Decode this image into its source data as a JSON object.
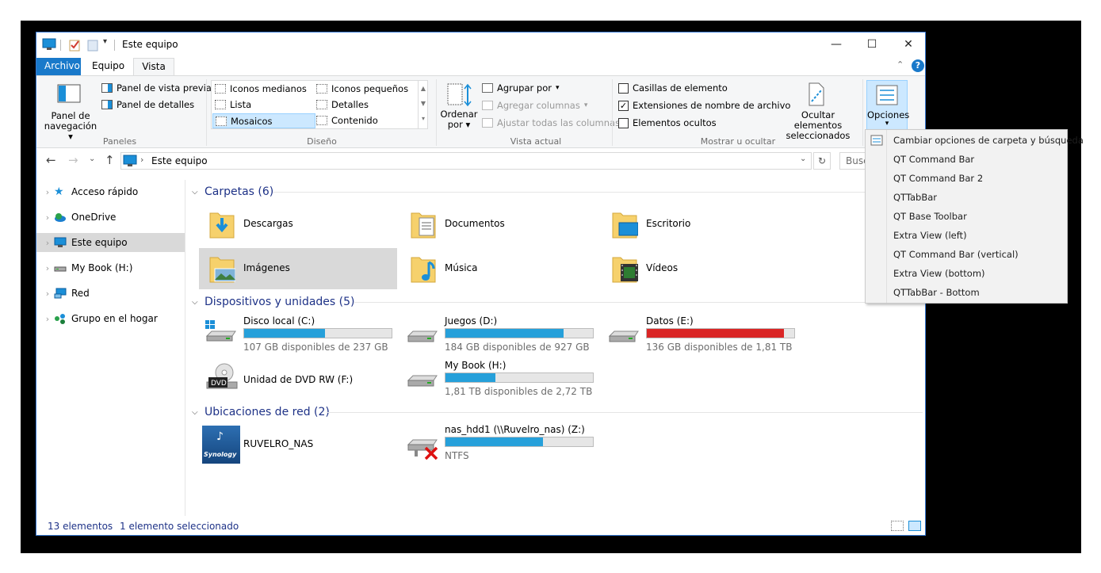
{
  "window": {
    "title": "Este equipo",
    "controls": {
      "minimize": "—",
      "maximize": "☐",
      "close": "✕"
    }
  },
  "tabs": [
    {
      "label": "Archivo"
    },
    {
      "label": "Equipo"
    },
    {
      "label": "Vista"
    }
  ],
  "ribbon": {
    "panes": {
      "nav_pane_label": "Panel de navegación",
      "preview_pane": "Panel de vista previa",
      "details_pane": "Panel de detalles",
      "group_label": "Paneles"
    },
    "layout": {
      "items": [
        "Iconos medianos",
        "Iconos pequeños",
        "Lista",
        "Detalles",
        "Mosaicos",
        "Contenido"
      ],
      "selected": "Mosaicos",
      "group_label": "Diseño"
    },
    "current_view": {
      "sort_label": "Ordenar por",
      "group_by": "Agrupar por",
      "add_columns": "Agregar columnas",
      "fit_columns": "Ajustar todas las columnas",
      "group_label": "Vista actual"
    },
    "show_hide": {
      "item_checkboxes": {
        "label": "Casillas de elemento",
        "checked": false
      },
      "file_extensions": {
        "label": "Extensiones de nombre de archivo",
        "checked": true
      },
      "hidden_items": {
        "label": "Elementos ocultos",
        "checked": false
      },
      "hide_selected": "Ocultar elementos seleccionados",
      "group_label": "Mostrar u ocultar"
    },
    "options_label": "Opciones"
  },
  "address": {
    "path": "Este equipo",
    "search_placeholder": "Busc"
  },
  "nav_pane": [
    {
      "label": "Acceso rápido",
      "icon": "star-icon"
    },
    {
      "label": "OneDrive",
      "icon": "cloud-icon"
    },
    {
      "label": "Este equipo",
      "icon": "computer-icon",
      "selected": true
    },
    {
      "label": "My Book (H:)",
      "icon": "drive-icon"
    },
    {
      "label": "Red",
      "icon": "network-icon"
    },
    {
      "label": "Grupo en el hogar",
      "icon": "homegroup-icon"
    }
  ],
  "sections": {
    "folders": "Carpetas (6)",
    "devices": "Dispositivos y unidades (5)",
    "network": "Ubicaciones de red (2)"
  },
  "folders": [
    {
      "name": "Descargas",
      "icon": "downloads-folder-icon"
    },
    {
      "name": "Documentos",
      "icon": "documents-folder-icon"
    },
    {
      "name": "Escritorio",
      "icon": "desktop-folder-icon"
    },
    {
      "name": "Imágenes",
      "icon": "pictures-folder-icon",
      "selected": true
    },
    {
      "name": "Música",
      "icon": "music-folder-icon"
    },
    {
      "name": "Vídeos",
      "icon": "videos-folder-icon"
    }
  ],
  "drives": [
    {
      "name": "Disco local (C:)",
      "free": "107 GB disponibles de 237 GB",
      "used_fraction": 0.55,
      "color": "#26a0da"
    },
    {
      "name": "Juegos (D:)",
      "free": "184 GB disponibles de 927 GB",
      "used_fraction": 0.8,
      "color": "#26a0da"
    },
    {
      "name": "Datos (E:)",
      "free": "136 GB disponibles de 1,81 TB",
      "used_fraction": 0.93,
      "color": "#da2626"
    },
    {
      "name": "Unidad de DVD RW (F:)"
    },
    {
      "name": "My Book (H:)",
      "free": "1,81 TB disponibles de 2,72 TB",
      "used_fraction": 0.34,
      "color": "#26a0da"
    }
  ],
  "network_locations": [
    {
      "name": "RUVELRO_NAS",
      "icon": "synology-icon"
    },
    {
      "name": "nas_hdd1 (\\\\Ruvelro_nas) (Z:)",
      "free": "NTFS",
      "used_fraction": 0.66,
      "color": "#26a0da"
    }
  ],
  "status": {
    "count": "13 elementos",
    "selected": "1 elemento seleccionado"
  },
  "options_menu": [
    "Cambiar opciones de carpeta y búsqueda",
    "QT Command Bar",
    "QT Command Bar 2",
    "QTTabBar",
    "QT Base Toolbar",
    "Extra View (left)",
    "QT Command Bar (vertical)",
    "Extra View (bottom)",
    "QTTabBar - Bottom"
  ],
  "colors": {
    "accent": "#1979ca",
    "bar_normal": "#26a0da",
    "bar_full": "#da2626",
    "selection": "#d9d9d9",
    "section_text": "#1e3287"
  }
}
